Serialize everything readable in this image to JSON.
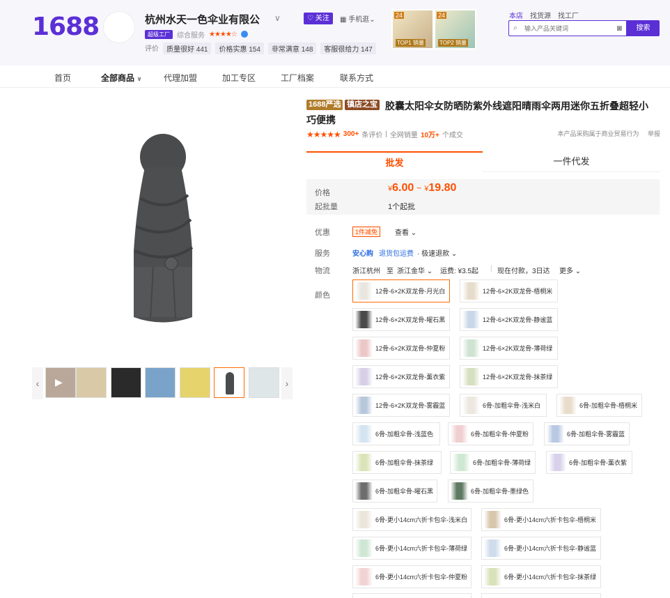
{
  "header": {
    "logo": "1688",
    "shop_name": "杭州水天一色伞业有限公",
    "follow_label": "关注",
    "mobile_label": "手机逛",
    "level_badge": "超级工厂",
    "service_label": "综合服务",
    "metrics_label": "评价",
    "metrics": [
      {
        "label": "质量很好 441"
      },
      {
        "label": "价格实惠 154"
      },
      {
        "label": "非常满意 148"
      },
      {
        "label": "客服很给力 147"
      }
    ],
    "top_cards": [
      {
        "num": "24",
        "tag": "TOP1 销量"
      },
      {
        "num": "24",
        "tag": "TOP2 销量"
      }
    ],
    "search_tabs": [
      "本店",
      "找货源",
      "找工厂"
    ],
    "search_placeholder": "输入产品关键词",
    "search_button": "搜索"
  },
  "nav": {
    "items": [
      "首页",
      "全部商品",
      "代理加盟",
      "加工专区",
      "工厂档案",
      "联系方式"
    ]
  },
  "product": {
    "tags": [
      "1688严选",
      "镇店之宝"
    ],
    "tag_colors": [
      "#b07c2a",
      "#9a5a2a"
    ],
    "title": "胶囊太阳伞女防晒防紫外线遮阳晴雨伞两用迷你五折叠超轻小巧便携",
    "rating_stars": 4.5,
    "review_count": "300+",
    "review_label": "条评价",
    "sales_prefix": "全网销量",
    "sales_count": "10万+",
    "sales_suffix": "个成交",
    "right_note": "本产品采购属于商业贸易行为",
    "report": "举报"
  },
  "tabs": {
    "wholesale": "批发",
    "dropship": "一件代发"
  },
  "price_box": {
    "price_label": "价格",
    "currency": "¥",
    "price_low": "6.00",
    "tilde": "~",
    "price_high": "19.80",
    "moq_label": "起批量",
    "moq_value": "1个起批"
  },
  "info": {
    "discount_label": "优惠",
    "coupon": "1件减免",
    "coupon_more": "查看",
    "service_label": "服务",
    "service_1": "安心购",
    "service_2": "退货包运费",
    "service_3": "· 极速退款",
    "logistics_label": "物流",
    "from": "浙江杭州",
    "to_word": "至",
    "to": "浙江金华",
    "freight": "运费: ¥3.5起",
    "ship_time": "现在付款，3日达",
    "more": "更多",
    "color_label": "颜色"
  },
  "colors": {
    "options": [
      {
        "label": "12骨-6×2K双龙骨-月光白",
        "swatch": "#e9e6df"
      },
      {
        "label": "12骨-6×2K双龙骨-梧桐米",
        "swatch": "#e6dccb"
      },
      {
        "label": "12骨-6×2K双龙骨-曜石黑",
        "swatch": "#4a4a4a"
      },
      {
        "label": "12骨-6×2K双龙骨-静谧蓝",
        "swatch": "#c9d7e8"
      },
      {
        "label": "12骨-6×2K双龙骨-仲夏粉",
        "swatch": "#ecc7c8"
      },
      {
        "label": "12骨-6×2K双龙骨-薄荷绿",
        "swatch": "#cfe3d2"
      },
      {
        "label": "12骨-6×2K双龙骨-薰衣紫",
        "swatch": "#d7cfe6"
      },
      {
        "label": "12骨-6×2K双龙骨-抹茶绿",
        "swatch": "#d6dfbf"
      },
      {
        "label": "12骨-6×2K双龙骨-雾霾蓝",
        "swatch": "#b8c8dc"
      },
      {
        "label": "6骨-加粗伞骨-浅米白",
        "swatch": "#ece8e0"
      },
      {
        "label": "6骨-加粗伞骨-梧桐米",
        "swatch": "#e8dccb"
      },
      {
        "label": "6骨-加粗伞骨-浅蓝色",
        "swatch": "#d5e4f1"
      },
      {
        "label": "6骨-加粗伞骨-仲夏粉",
        "swatch": "#f0cfd0"
      },
      {
        "label": "6骨-加粗伞骨-雾霾蓝",
        "swatch": "#b9c9e3"
      },
      {
        "label": "6骨-加粗伞骨-抹茶绿",
        "swatch": "#dbe4b8"
      },
      {
        "label": "6骨-加粗伞骨-薄荷绿",
        "swatch": "#cfe8d3"
      },
      {
        "label": "6骨-加粗伞骨-薰衣紫",
        "swatch": "#d8d1ea"
      },
      {
        "label": "6骨-加粗伞骨-曜石黑",
        "swatch": "#6d6d6d"
      },
      {
        "label": "6骨-加粗伞骨-墨绿色",
        "swatch": "#5e7a62"
      },
      {
        "label": "6骨-更小14cm六折卡包伞-浅米白",
        "swatch": "#ebe5db"
      },
      {
        "label": "6骨-更小14cm六折卡包伞-梧桐米",
        "swatch": "#d8c6ad"
      },
      {
        "label": "6骨-更小14cm六折卡包伞-薄荷绿",
        "swatch": "#cfe6d4"
      },
      {
        "label": "6骨-更小14cm六折卡包伞-静谧蓝",
        "swatch": "#cfdcec"
      },
      {
        "label": "6骨-更小14cm六折卡包伞-仲夏粉",
        "swatch": "#f1d3d3"
      },
      {
        "label": "6骨-更小14cm六折卡包伞-抹茶绿",
        "swatch": "#d8e1b9"
      }
    ]
  },
  "gallery": {
    "main_color": "#4a4b4c",
    "thumbs": [
      {
        "name": "thumb-video",
        "color": "#b9a89a"
      },
      {
        "name": "thumb-2",
        "color": "#d9c9a7"
      },
      {
        "name": "thumb-3",
        "color": "#2a2a2a"
      },
      {
        "name": "thumb-4",
        "color": "#7aa3c9"
      },
      {
        "name": "thumb-5",
        "color": "#e6d36b"
      },
      {
        "name": "thumb-6",
        "color": "#4a4b4c"
      },
      {
        "name": "thumb-7",
        "color": "#dfe6e8"
      }
    ],
    "prev": "‹",
    "next": "›"
  }
}
